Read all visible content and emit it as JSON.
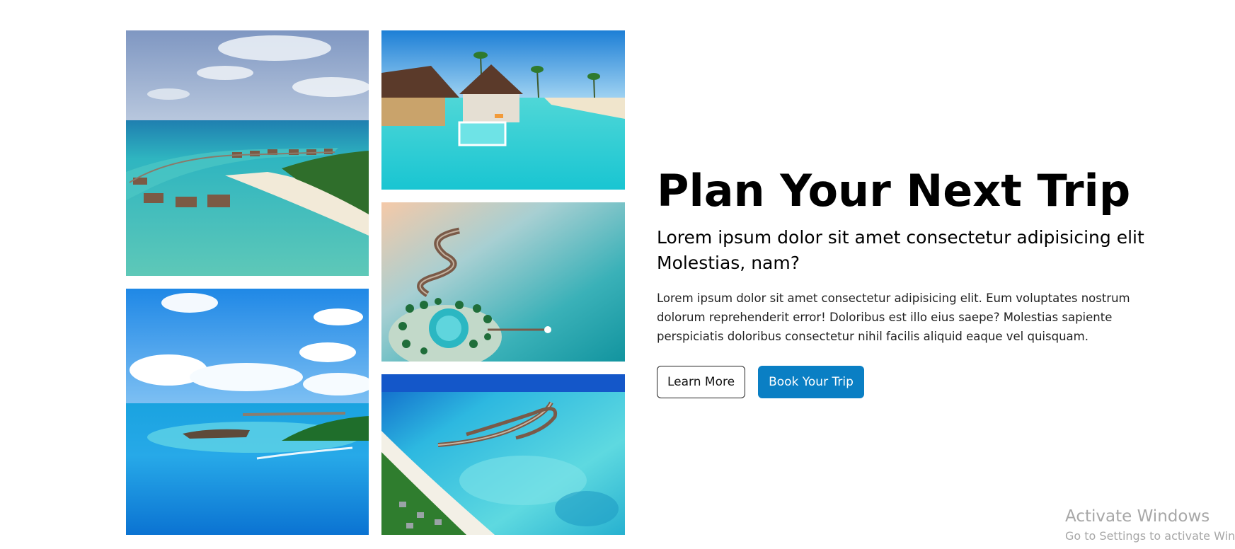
{
  "hero": {
    "title": "Plan Your Next Trip",
    "subtitle": "Lorem ipsum dolor sit amet consectetur adipisicing elit Molestias, nam?",
    "body": "Lorem ipsum dolor sit amet consectetur adipisicing elit. Eum voluptates nostrum dolorum reprehenderit error! Doloribus est illo eius saepe? Molestias sapiente perspiciatis doloribus consectetur nihil facilis aliquid eaque vel quisquam.",
    "learn_more_label": "Learn More",
    "book_trip_label": "Book Your Trip",
    "colors": {
      "primary_button": "#0a7fc4",
      "primary_text": "#ffffff",
      "outline_border": "#222222"
    }
  },
  "gallery": {
    "photos": [
      "overwater-villas-aerial-photo",
      "island-aerial-speedboat-photo",
      "beach-villa-pool-photo",
      "sunset-resort-pier-photo",
      "reef-resort-aerial-photo"
    ]
  },
  "system": {
    "watermark_title": "Activate Windows",
    "watermark_subtitle": "Go to Settings to activate Windows."
  }
}
